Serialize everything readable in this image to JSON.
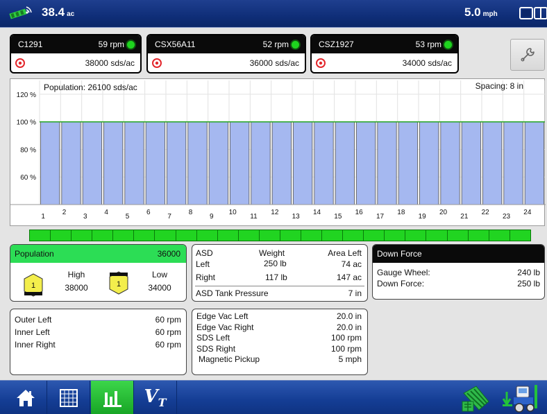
{
  "header": {
    "area_value": "38.4",
    "area_unit": "ac",
    "speed_value": "5.0",
    "speed_unit": "mph",
    "icons": [
      "gps-satellite-icon",
      "screen-split-icon"
    ]
  },
  "products": [
    {
      "name": "C1291",
      "rpm": "59 rpm",
      "rate": "38000 sds/ac"
    },
    {
      "name": "CSX56A11",
      "rpm": "52 rpm",
      "rate": "36000 sds/ac"
    },
    {
      "name": "CSZ1927",
      "rpm": "53 rpm",
      "rate": "34000 sds/ac"
    }
  ],
  "chart_data": {
    "type": "bar",
    "title": "Population: 26100 sds/ac",
    "annotation": "Spacing: 8 in",
    "categories": [
      "1",
      "2",
      "3",
      "4",
      "5",
      "6",
      "7",
      "8",
      "9",
      "10",
      "11",
      "12",
      "13",
      "14",
      "15",
      "16",
      "17",
      "18",
      "19",
      "20",
      "21",
      "22",
      "23",
      "24"
    ],
    "values": [
      100,
      100,
      100,
      100,
      100,
      100,
      100,
      100,
      100,
      100,
      100,
      100,
      100,
      100,
      100,
      100,
      100,
      100,
      100,
      100,
      100,
      100,
      100,
      100
    ],
    "yticks": [
      "120 %",
      "100 %",
      "80 %",
      "60 %"
    ],
    "ylim": [
      40,
      130
    ],
    "reference_line": 100,
    "grid": true,
    "bar_color": "#a5b8f0"
  },
  "row_status": {
    "count": 24,
    "color": "#21d421"
  },
  "population_panel": {
    "label": "Population",
    "value": "36000",
    "high_label": "High",
    "high_value": "38000",
    "low_label": "Low",
    "low_value": "34000",
    "high_badge": "1",
    "low_badge": "1"
  },
  "asd_panel": {
    "title": "ASD",
    "weight_header": "Weight",
    "area_header": "Area Left",
    "left_label": "Left",
    "left_weight": "250 lb",
    "left_area": "74 ac",
    "right_label": "Right",
    "right_weight": "117 lb",
    "right_area": "147 ac",
    "pressure_label": "ASD Tank Pressure",
    "pressure_value": "7 in"
  },
  "down_force_panel": {
    "title": "Down Force",
    "gauge_label": "Gauge Wheel:",
    "gauge_value": "240 lb",
    "force_label": "Down Force:",
    "force_value": "250 lb"
  },
  "fan_panel": {
    "rows": [
      {
        "label": "Outer Left",
        "value": "60 rpm"
      },
      {
        "label": "Inner Left",
        "value": "60 rpm"
      },
      {
        "label": "Inner Right",
        "value": "60 rpm"
      }
    ]
  },
  "vac_panel": {
    "rows": [
      {
        "label": "Edge Vac Left",
        "value": "20.0 in"
      },
      {
        "label": "Edge Vac Right",
        "value": "20.0 in"
      },
      {
        "label": "SDS Left",
        "value": "100 rpm"
      },
      {
        "label": "SDS Right",
        "value": "100 rpm"
      },
      {
        "label": "Magnetic Pickup",
        "value": "5 mph"
      }
    ]
  },
  "navbar": {
    "vt_label": "V",
    "vt_sub": "T",
    "items": [
      "home-icon",
      "grid-icon",
      "run-screen-icon",
      "virtual-terminal-icon",
      "field-map-icon",
      "planter-icon"
    ]
  }
}
